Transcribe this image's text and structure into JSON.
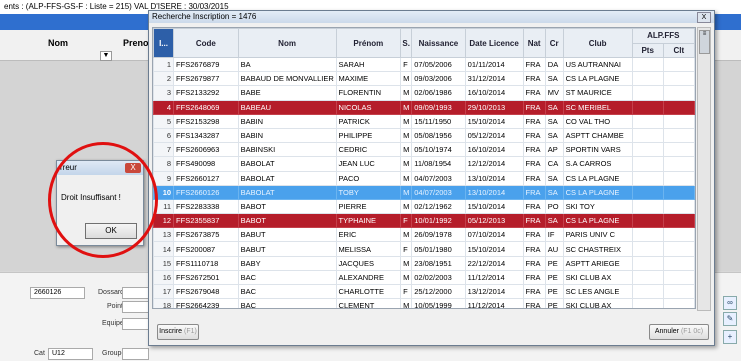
{
  "background": {
    "title": "ents : (ALP-FFS-GS-F : Liste = 215) VAL D'ISERE : 30/03/2015",
    "columns": [
      "Nom",
      "Prenom"
    ],
    "dropdown_arrow": "▼",
    "dossard_value": "2660126",
    "fields": {
      "dossard": "Dossard",
      "point": "Point",
      "equipe": "Equipe",
      "groupe": "Groupe",
      "cat_label": "Cat",
      "cat_value": "U12"
    }
  },
  "error_dialog": {
    "title": "rreur",
    "close": "X",
    "message": "Droit Insuffisant !",
    "ok": "OK"
  },
  "dialog": {
    "title": "Recherche Inscription = 1476",
    "close": "X",
    "inscrire": "Inscrire",
    "inscrire_key": "(F1)",
    "annuler": "Annuler",
    "annuler_key": "(F1 0c)"
  },
  "table": {
    "headers": [
      "I...",
      "Code",
      "Nom",
      "Prénom",
      "S.",
      "Naissance",
      "Date Licence",
      "Nat",
      "Cr",
      "Club",
      "Pts",
      "Clt"
    ],
    "group_header": "ALP.FFS",
    "rows": [
      [
        "1",
        "FFS2676879",
        "BA",
        "SARAH",
        "F",
        "07/05/2006",
        "01/11/2014",
        "FRA",
        "DA",
        "US AUTRANNAI",
        "",
        ""
      ],
      [
        "2",
        "FFS2679877",
        "BABAUD DE MONVALLIER",
        "MAXIME",
        "M",
        "09/03/2006",
        "31/12/2014",
        "FRA",
        "SA",
        "CS LA PLAGNE",
        "",
        ""
      ],
      [
        "3",
        "FFS2133292",
        "BABE",
        "FLORENTIN",
        "M",
        "02/06/1986",
        "16/10/2014",
        "FRA",
        "MV",
        "ST MAURICE",
        "",
        ""
      ],
      [
        "4",
        "FFS2648069",
        "BABEAU",
        "NICOLAS",
        "M",
        "09/09/1993",
        "29/10/2013",
        "FRA",
        "SA",
        "SC MERIBEL",
        "",
        ""
      ],
      [
        "5",
        "FFS2153298",
        "BABIN",
        "PATRICK",
        "M",
        "15/11/1950",
        "15/10/2014",
        "FRA",
        "SA",
        "CO VAL THO",
        "",
        ""
      ],
      [
        "6",
        "FFS1343287",
        "BABIN",
        "PHILIPPE",
        "M",
        "05/08/1956",
        "05/12/2014",
        "FRA",
        "SA",
        "ASPTT CHAMBE",
        "",
        ""
      ],
      [
        "7",
        "FFS2606963",
        "BABINSKI",
        "CEDRIC",
        "M",
        "05/10/1974",
        "16/10/2014",
        "FRA",
        "AP",
        "SPORTIN VARS",
        "",
        ""
      ],
      [
        "8",
        "FFS490098",
        "BABOLAT",
        "JEAN LUC",
        "M",
        "11/08/1954",
        "12/12/2014",
        "FRA",
        "CA",
        "S.A CARROS",
        "",
        ""
      ],
      [
        "9",
        "FFS2660127",
        "BABOLAT",
        "PACO",
        "M",
        "04/07/2003",
        "13/10/2014",
        "FRA",
        "SA",
        "CS LA PLAGNE",
        "",
        ""
      ],
      [
        "10",
        "FFS2660126",
        "BABOLAT",
        "TOBY",
        "M",
        "04/07/2003",
        "13/10/2014",
        "FRA",
        "SA",
        "CS LA PLAGNE",
        "",
        ""
      ],
      [
        "11",
        "FFS2283338",
        "BABOT",
        "PIERRE",
        "M",
        "02/12/1962",
        "15/10/2014",
        "FRA",
        "PO",
        "SKI TOY",
        "",
        ""
      ],
      [
        "12",
        "FFS2355837",
        "BABOT",
        "TYPHAINE",
        "F",
        "10/01/1992",
        "05/12/2013",
        "FRA",
        "SA",
        "CS LA PLAGNE",
        "",
        ""
      ],
      [
        "13",
        "FFS2673875",
        "BABUT",
        "ERIC",
        "M",
        "26/09/1978",
        "07/10/2014",
        "FRA",
        "IF",
        "PARIS UNIV C",
        "",
        ""
      ],
      [
        "14",
        "FFS200087",
        "BABUT",
        "MELISSA",
        "F",
        "05/01/1980",
        "15/10/2014",
        "FRA",
        "AU",
        "SC CHASTREIX",
        "",
        ""
      ],
      [
        "15",
        "FFS1110718",
        "BABY",
        "JACQUES",
        "M",
        "23/08/1951",
        "22/12/2014",
        "FRA",
        "PE",
        "ASPTT ARIEGE",
        "",
        ""
      ],
      [
        "16",
        "FFS2672501",
        "BAC",
        "ALEXANDRE",
        "M",
        "02/02/2003",
        "11/12/2014",
        "FRA",
        "PE",
        "SKI CLUB AX",
        "",
        ""
      ],
      [
        "17",
        "FFS2679048",
        "BAC",
        "CHARLOTTE",
        "F",
        "25/12/2000",
        "13/12/2014",
        "FRA",
        "PE",
        "SC LES ANGLE",
        "",
        ""
      ],
      [
        "18",
        "FFS2664239",
        "BAC",
        "CLEMENT",
        "M",
        "10/05/1999",
        "11/12/2014",
        "FRA",
        "PE",
        "SKI CLUB AX",
        "",
        ""
      ],
      [
        "19",
        "FFS2679049",
        "BAC",
        "VICTOR",
        "M",
        "19/11/2002",
        "13/12/2014",
        "FRA",
        "PE",
        "SC LES ANGLE",
        "",
        ""
      ]
    ],
    "row_states": [
      "",
      "",
      "",
      "red",
      "",
      "",
      "",
      "",
      "",
      "blue",
      "",
      "red",
      "",
      "",
      "",
      "",
      "",
      "",
      ""
    ]
  },
  "colors": {
    "red_row": "#b51d2a",
    "selected_row": "#4aa1ec",
    "title_bar": "#2f6fcf",
    "annotation": "#e01010"
  }
}
